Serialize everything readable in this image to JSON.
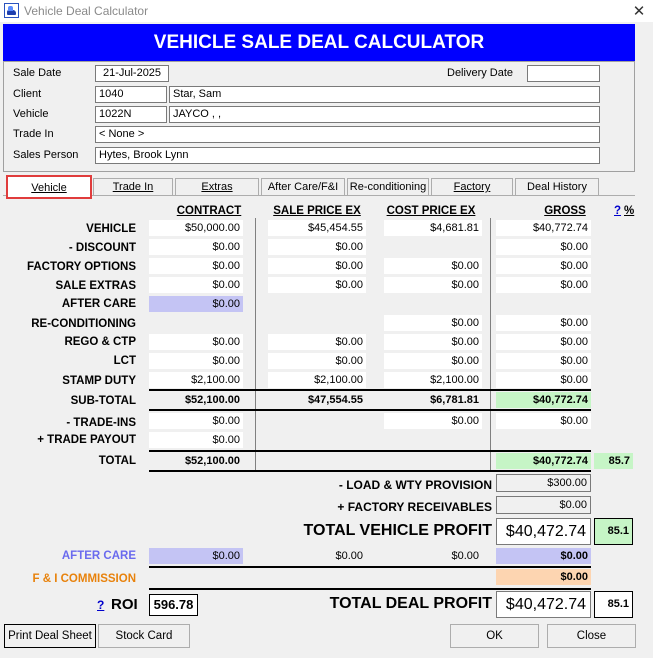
{
  "window": {
    "title": "Vehicle Deal Calculator",
    "close_glyph": "✕"
  },
  "banner": "VEHICLE SALE DEAL CALCULATOR",
  "info": {
    "sale_date_label": "Sale Date",
    "sale_date": "21-Jul-2025",
    "delivery_date_label": "Delivery Date",
    "delivery_date": "",
    "client_label": "Client",
    "client_code": "1040",
    "client_name": "Star, Sam",
    "vehicle_label": "Vehicle",
    "vehicle_code": "1022N",
    "vehicle_desc": "JAYCO  , ,",
    "trade_in_label": "Trade In",
    "trade_in": "< None >",
    "sales_person_label": "Sales Person",
    "sales_person": "Hytes, Brook Lynn"
  },
  "tabs": [
    "Vehicle",
    "Trade In",
    "Extras",
    "After Care/F&I",
    "Re-conditioning",
    "Factory",
    "Deal History"
  ],
  "headers": {
    "contract": "CONTRACT",
    "sale_price_ex": "SALE PRICE EX",
    "cost_price_ex": "COST PRICE EX",
    "gross": "GROSS",
    "help_q": "?",
    "percent": "%"
  },
  "rows": {
    "vehicle": {
      "label": "VEHICLE",
      "contract": "$50,000.00",
      "sale": "$45,454.55",
      "cost": "$4,681.81",
      "gross": "$40,772.74"
    },
    "discount": {
      "label": "- DISCOUNT",
      "contract": "$0.00",
      "sale": "$0.00",
      "gross": "$0.00"
    },
    "factory_options": {
      "label": "FACTORY OPTIONS",
      "contract": "$0.00",
      "sale": "$0.00",
      "cost": "$0.00",
      "gross": "$0.00"
    },
    "sale_extras": {
      "label": "SALE EXTRAS",
      "contract": "$0.00",
      "sale": "$0.00",
      "cost": "$0.00",
      "gross": "$0.00"
    },
    "after_care": {
      "label": "AFTER CARE",
      "contract": "$0.00"
    },
    "reconditioning": {
      "label": "RE-CONDITIONING",
      "cost": "$0.00",
      "gross": "$0.00"
    },
    "rego_ctp": {
      "label": "REGO & CTP",
      "contract": "$0.00",
      "sale": "$0.00",
      "cost": "$0.00",
      "gross": "$0.00"
    },
    "lct": {
      "label": "LCT",
      "contract": "$0.00",
      "sale": "$0.00",
      "cost": "$0.00",
      "gross": "$0.00"
    },
    "stamp_duty": {
      "label": "STAMP DUTY",
      "contract": "$2,100.00",
      "sale": "$2,100.00",
      "cost": "$2,100.00",
      "gross": "$0.00"
    },
    "sub_total": {
      "label": "SUB-TOTAL",
      "contract": "$52,100.00",
      "sale": "$47,554.55",
      "cost": "$6,781.81",
      "gross": "$40,772.74"
    },
    "trade_ins": {
      "label": "- TRADE-INS",
      "contract": "$0.00",
      "cost": "$0.00",
      "gross": "$0.00"
    },
    "trade_payout": {
      "label": "+ TRADE PAYOUT",
      "contract": "$0.00"
    },
    "total": {
      "label": "TOTAL",
      "contract": "$52,100.00",
      "gross": "$40,772.74",
      "pct": "85.7"
    }
  },
  "provisions": {
    "load_label": "- LOAD & WTY PROVISION",
    "load_value": "$300.00",
    "factory_recv_label": "+ FACTORY RECEIVABLES",
    "factory_recv_value": "$0.00"
  },
  "vehicle_profit": {
    "label": "TOTAL VEHICLE PROFIT",
    "value": "$40,472.74",
    "pct": "85.1"
  },
  "after_care_summary": {
    "label": "AFTER CARE",
    "contract": "$0.00",
    "sale": "$0.00",
    "cost": "$0.00",
    "gross": "$0.00"
  },
  "fi_commission": {
    "label": "F & I COMMISSION",
    "gross": "$0.00"
  },
  "roi": {
    "help": "?",
    "label": "ROI",
    "value": "596.78"
  },
  "deal_profit": {
    "label": "TOTAL DEAL PROFIT",
    "value": "$40,472.74",
    "pct": "85.1"
  },
  "buttons": {
    "print": "Print Deal Sheet",
    "stock": "Stock Card",
    "ok": "OK",
    "close": "Close"
  },
  "colors": {
    "banner": "#0000ff",
    "green": "#c6f5c6",
    "purple": "#c4c4f4",
    "peach": "#fdd5b1",
    "after_care_label": "#6a6aee",
    "fi_label": "#e8820c",
    "help_link": "#0000cc"
  }
}
